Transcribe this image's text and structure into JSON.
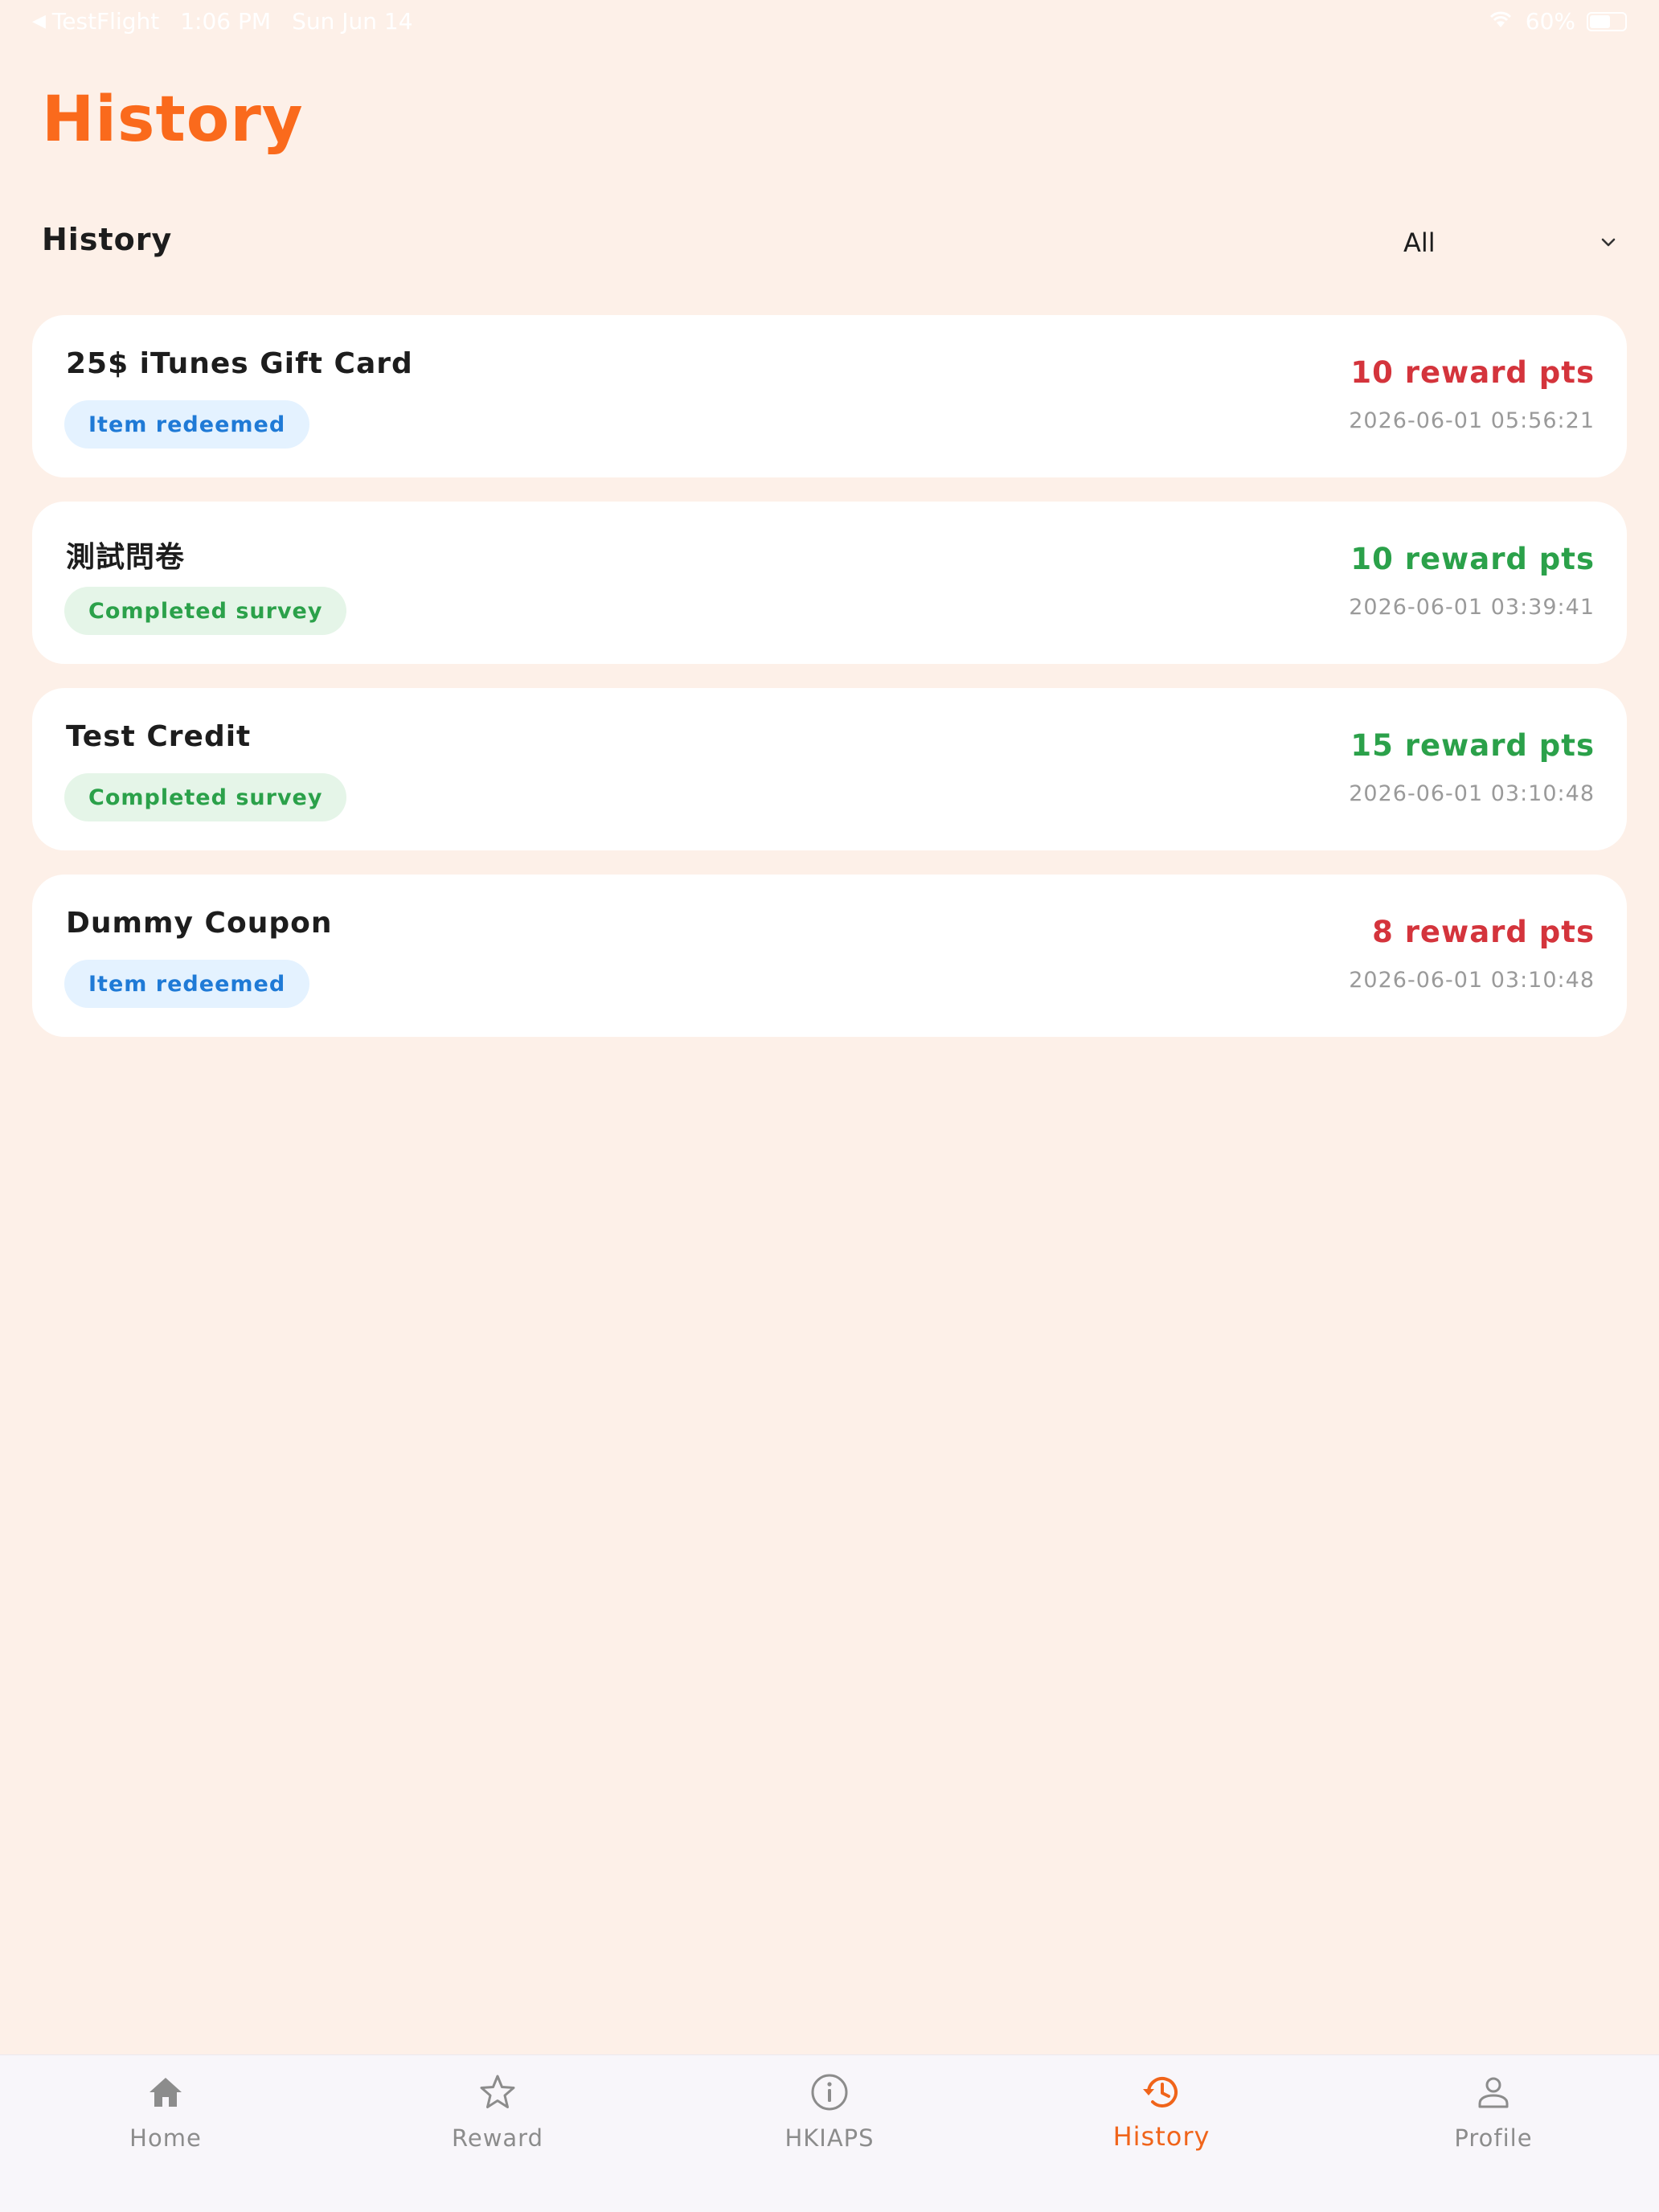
{
  "status_bar": {
    "back_app": "TestFlight",
    "time": "1:06 PM",
    "date": "Sun Jun 14",
    "battery": "60%",
    "battery_level": 0.6
  },
  "page_title": "History",
  "section": {
    "title": "History",
    "filter_value": "All"
  },
  "records": [
    {
      "title": "25$ iTunes Gift Card",
      "badge": "Item redeemed",
      "badge_type": "redeemed",
      "points": "10 reward pts",
      "points_color": "#d4343c",
      "timestamp": "2026-06-01 05:56:21"
    },
    {
      "title": "測試問卷",
      "badge": "Completed survey",
      "badge_type": "survey",
      "points": "10 reward pts",
      "points_color": "#2ba14a",
      "timestamp": "2026-06-01 03:39:41"
    },
    {
      "title": "Test Credit",
      "badge": "Completed survey",
      "badge_type": "survey",
      "points": "15 reward pts",
      "points_color": "#2ba14a",
      "timestamp": "2026-06-01 03:10:48"
    },
    {
      "title": "Dummy Coupon",
      "badge": "Item redeemed",
      "badge_type": "redeemed",
      "points": "8 reward pts",
      "points_color": "#d4343c",
      "timestamp": "2026-06-01 03:10:48"
    }
  ],
  "tabs": [
    {
      "label": "Home",
      "icon": "home-icon"
    },
    {
      "label": "Reward",
      "icon": "star-icon"
    },
    {
      "label": "HKIAPS",
      "icon": "info-icon"
    },
    {
      "label": "History",
      "icon": "history-icon",
      "active": true
    },
    {
      "label": "Profile",
      "icon": "person-icon"
    }
  ],
  "colors": {
    "accent": "#fa6a1c",
    "background": "#fdf0e8",
    "redeem_badge": "#1f7ad6",
    "survey_badge": "#2ba14a",
    "negative_points": "#d4343c"
  }
}
